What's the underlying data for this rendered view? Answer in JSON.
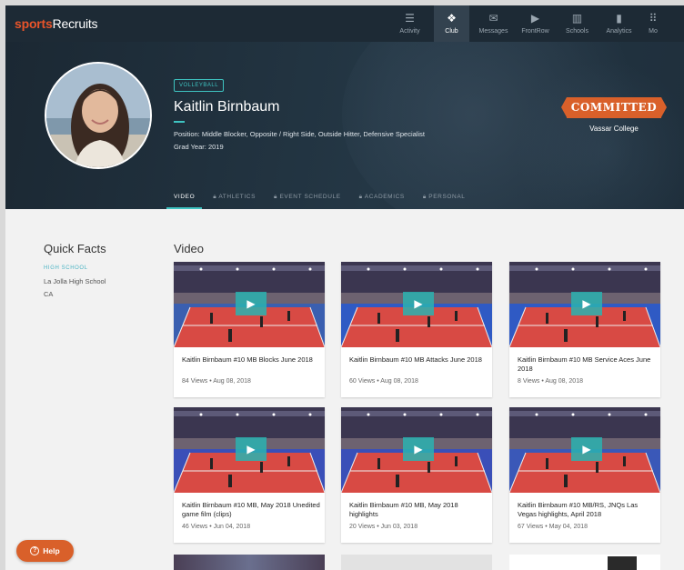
{
  "app": {
    "logo_prefix": "sports",
    "logo_suffix": "Recruits"
  },
  "nav": [
    {
      "label": "Activity",
      "icon": "list-icon",
      "glyph": "☰"
    },
    {
      "label": "Club",
      "icon": "paw-icon",
      "glyph": "❖"
    },
    {
      "label": "Messages",
      "icon": "envelope-icon",
      "glyph": "✉"
    },
    {
      "label": "FrontRow",
      "icon": "play-icon",
      "glyph": "▶"
    },
    {
      "label": "Schools",
      "icon": "building-icon",
      "glyph": "▥"
    },
    {
      "label": "Analytics",
      "icon": "bar-chart-icon",
      "glyph": "▮"
    },
    {
      "label": "Mo",
      "icon": "grid-icon",
      "glyph": "⠿"
    }
  ],
  "nav_active": "Club",
  "profile": {
    "sport": "VOLLEYBALL",
    "name": "Kaitlin Birnbaum",
    "position": "Position: Middle Blocker, Opposite / Right Side, Outside Hitter, Defensive Specialist",
    "grad_year": "Grad Year: 2019",
    "status": "COMMITTED",
    "college": "Vassar College"
  },
  "tabs": [
    {
      "label": "VIDEO",
      "locked": false,
      "active": true
    },
    {
      "label": "ATHLETICS",
      "locked": true,
      "active": false
    },
    {
      "label": "EVENT SCHEDULE",
      "locked": true,
      "active": false
    },
    {
      "label": "ACADEMICS",
      "locked": true,
      "active": false
    },
    {
      "label": "PERSONAL",
      "locked": true,
      "active": false
    }
  ],
  "quick_facts": {
    "title": "Quick Facts",
    "label": "HIGH SCHOOL",
    "school": "La Jolla High School",
    "state": "CA"
  },
  "videos_title": "Video",
  "videos": [
    {
      "title": "Kaitlin Birnbaum #10 MB Blocks June 2018",
      "meta": "84 Views • Aug 08, 2018"
    },
    {
      "title": "Kaitlin Birnbaum #10 MB Attacks June 2018",
      "meta": "60 Views • Aug 08, 2018"
    },
    {
      "title": "Kaitlin Birnbaum #10 MB Service Aces June 2018",
      "meta": "8 Views • Aug 08, 2018"
    },
    {
      "title": "Kaitlin Birnbaum #10 MB, May 2018 Unedited game film (clips)",
      "meta": "46 Views • Jun 04, 2018"
    },
    {
      "title": "Kaitlin Birnbaum #10 MB, May 2018 highlights",
      "meta": "20 Views • Jun 03, 2018"
    },
    {
      "title": "Kaitlin Birnbaum #10 MB/RS, JNQs Las Vegas highlights, April 2018",
      "meta": "67 Views • May 04, 2018"
    }
  ],
  "help_label": "Help",
  "colors": {
    "accent": "#3ec3c1",
    "brand": "#d9602a",
    "nav_bg": "#1d2a35"
  }
}
